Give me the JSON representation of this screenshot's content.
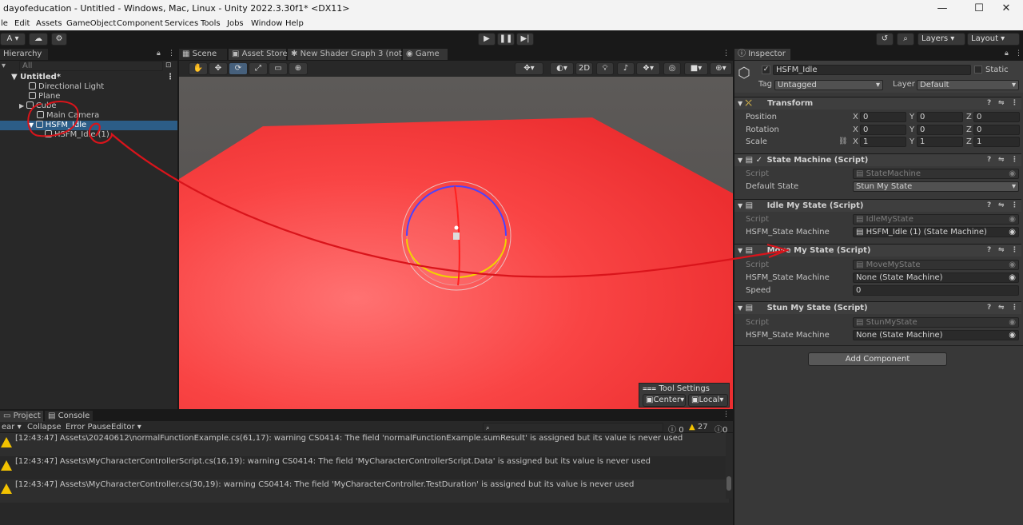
{
  "window": {
    "title": "dayofeducation - Untitled - Windows, Mac, Linux - Unity 2022.3.30f1* <DX11>",
    "min": "—",
    "max": "☐",
    "close": "✕"
  },
  "menu": [
    "le",
    "Edit",
    "Assets",
    "GameObject",
    "Component",
    "Services",
    "Tools",
    "Jobs",
    "Window",
    "Help"
  ],
  "toolbar": {
    "account": "A",
    "layers": "Layers",
    "layout": "Layout"
  },
  "hierarchy": {
    "tab": "Hierarchy",
    "search": "All",
    "scene": "Untitled*",
    "items": [
      "Directional Light",
      "Plane",
      "Cube",
      "Main Camera",
      "HSFM_Idle",
      "HSFM_Idle (1)"
    ]
  },
  "scene_tabs": [
    "Scene",
    "Asset Store",
    "New Shader Graph 3 (not...",
    "Game"
  ],
  "scene": {
    "mode2d": "2D",
    "tool_settings": "Tool Settings",
    "center": "Center",
    "local": "Local"
  },
  "inspector": {
    "tab": "Inspector",
    "name": "HSFM_Idle",
    "static": "Static",
    "tag_label": "Tag",
    "tag": "Untagged",
    "layer_label": "Layer",
    "layer": "Default",
    "transform": {
      "title": "Transform",
      "position": "Position",
      "rotation": "Rotation",
      "scale": "Scale",
      "pos": [
        "0",
        "0",
        "0"
      ],
      "rot": [
        "0",
        "0",
        "0"
      ],
      "scl": [
        "1",
        "1",
        "1"
      ],
      "x": "X",
      "y": "Y",
      "z": "Z"
    },
    "state_machine": {
      "title": "State Machine (Script)",
      "script_label": "Script",
      "script": "StateMachine",
      "default_label": "Default State",
      "default": "Stun My State"
    },
    "idle": {
      "title": "Idle My State (Script)",
      "script_label": "Script",
      "script": "IdleMyState",
      "sm_label": "HSFM_State Machine",
      "sm": "HSFM_Idle (1) (State Machine)"
    },
    "move": {
      "title": "Move My State (Script)",
      "script_label": "Script",
      "script": "MoveMyState",
      "sm_label": "HSFM_State Machine",
      "sm": "None (State Machine)",
      "speed_label": "Speed",
      "speed": "0"
    },
    "stun": {
      "title": "Stun My State (Script)",
      "script_label": "Script",
      "script": "StunMyState",
      "sm_label": "HSFM_State Machine",
      "sm": "None (State Machine)"
    },
    "add": "Add Component"
  },
  "bottom": {
    "project": "Project",
    "console": "Console",
    "clear": "ear",
    "collapse": "Collapse",
    "error_pause": "Error Pause",
    "editor": "Editor",
    "c_info": "0",
    "c_warn": "27",
    "c_err": "0",
    "logs": [
      "[12:43:47] Assets\\20240612\\normalFunctionExample.cs(61,17): warning CS0414: The field 'normalFunctionExample.sumResult' is assigned but its value is never used",
      "[12:43:47] Assets\\MyCharacterControllerScript.cs(16,19): warning CS0414: The field 'MyCharacterControllerScript.Data' is assigned but its value is never used",
      "[12:43:47] Assets\\MyCharacterController.cs(30,19): warning CS0414: The field 'MyCharacterController.TestDuration' is assigned but its value is never used"
    ]
  },
  "colors": {
    "plane": "#f53b3b",
    "selection": "#2c5d87",
    "annotation": "#d9141b"
  }
}
